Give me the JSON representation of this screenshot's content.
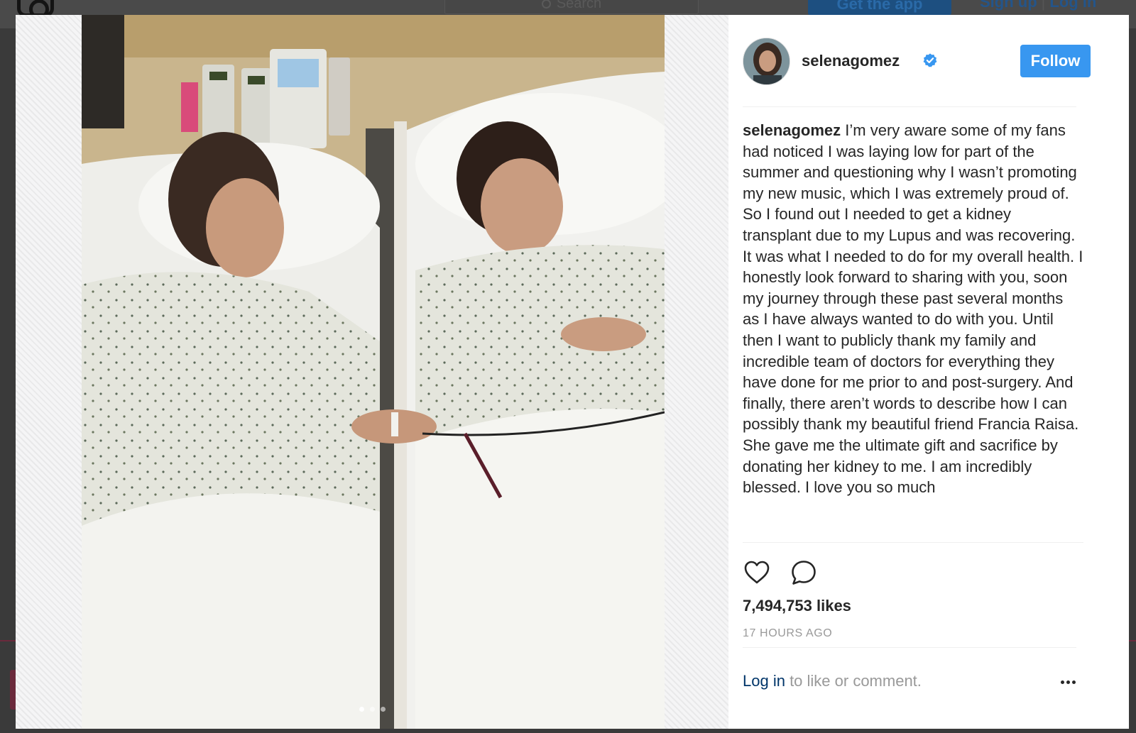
{
  "topbar": {
    "search_placeholder": "Search",
    "get_app_label": "Get the app",
    "sign_up_label": "Sign up",
    "separator": "|",
    "log_in_label": "Log in",
    "logo_icon": "instagram-logo-icon",
    "search_icon": "search-icon"
  },
  "post": {
    "image_icon": "photo-two-patients-holding-hands",
    "carousel": {
      "total": 3,
      "active": 1
    },
    "author": {
      "username": "selenagomez",
      "verified_icon": "verified-badge-icon",
      "follow_label": "Follow"
    },
    "caption": {
      "username": "selenagomez",
      "text": "I’m very aware some of my fans had noticed I was laying low for part of the summer and questioning why I wasn’t promoting my new music, which I was extremely proud of. So I found out I needed to get a kidney transplant due to my Lupus and was recovering. It was what I needed to do for my overall health. I honestly look forward to sharing with you, soon my journey through these past several months as I have always wanted to do with you. Until then I want to publicly thank my family and incredible team of doctors for everything they have done for me prior to and post-surgery. And finally, there aren’t words to describe how I can possibly thank my beautiful friend Francia Raisa. She gave me the ultimate gift and sacrifice by donating her kidney to me. I am incredibly blessed. I love you so much"
    },
    "actions": {
      "like_icon": "heart-icon",
      "comment_icon": "comment-icon"
    },
    "likes": "7,494,753 likes",
    "timestamp": "17 HOURS AGO",
    "footer": {
      "login_link": "Log in",
      "suffix": " to like or comment.",
      "more_icon": "more-options-icon"
    }
  },
  "colors": {
    "accent": "#3897f0",
    "link": "#003569",
    "text": "#262626",
    "muted": "#999999"
  }
}
